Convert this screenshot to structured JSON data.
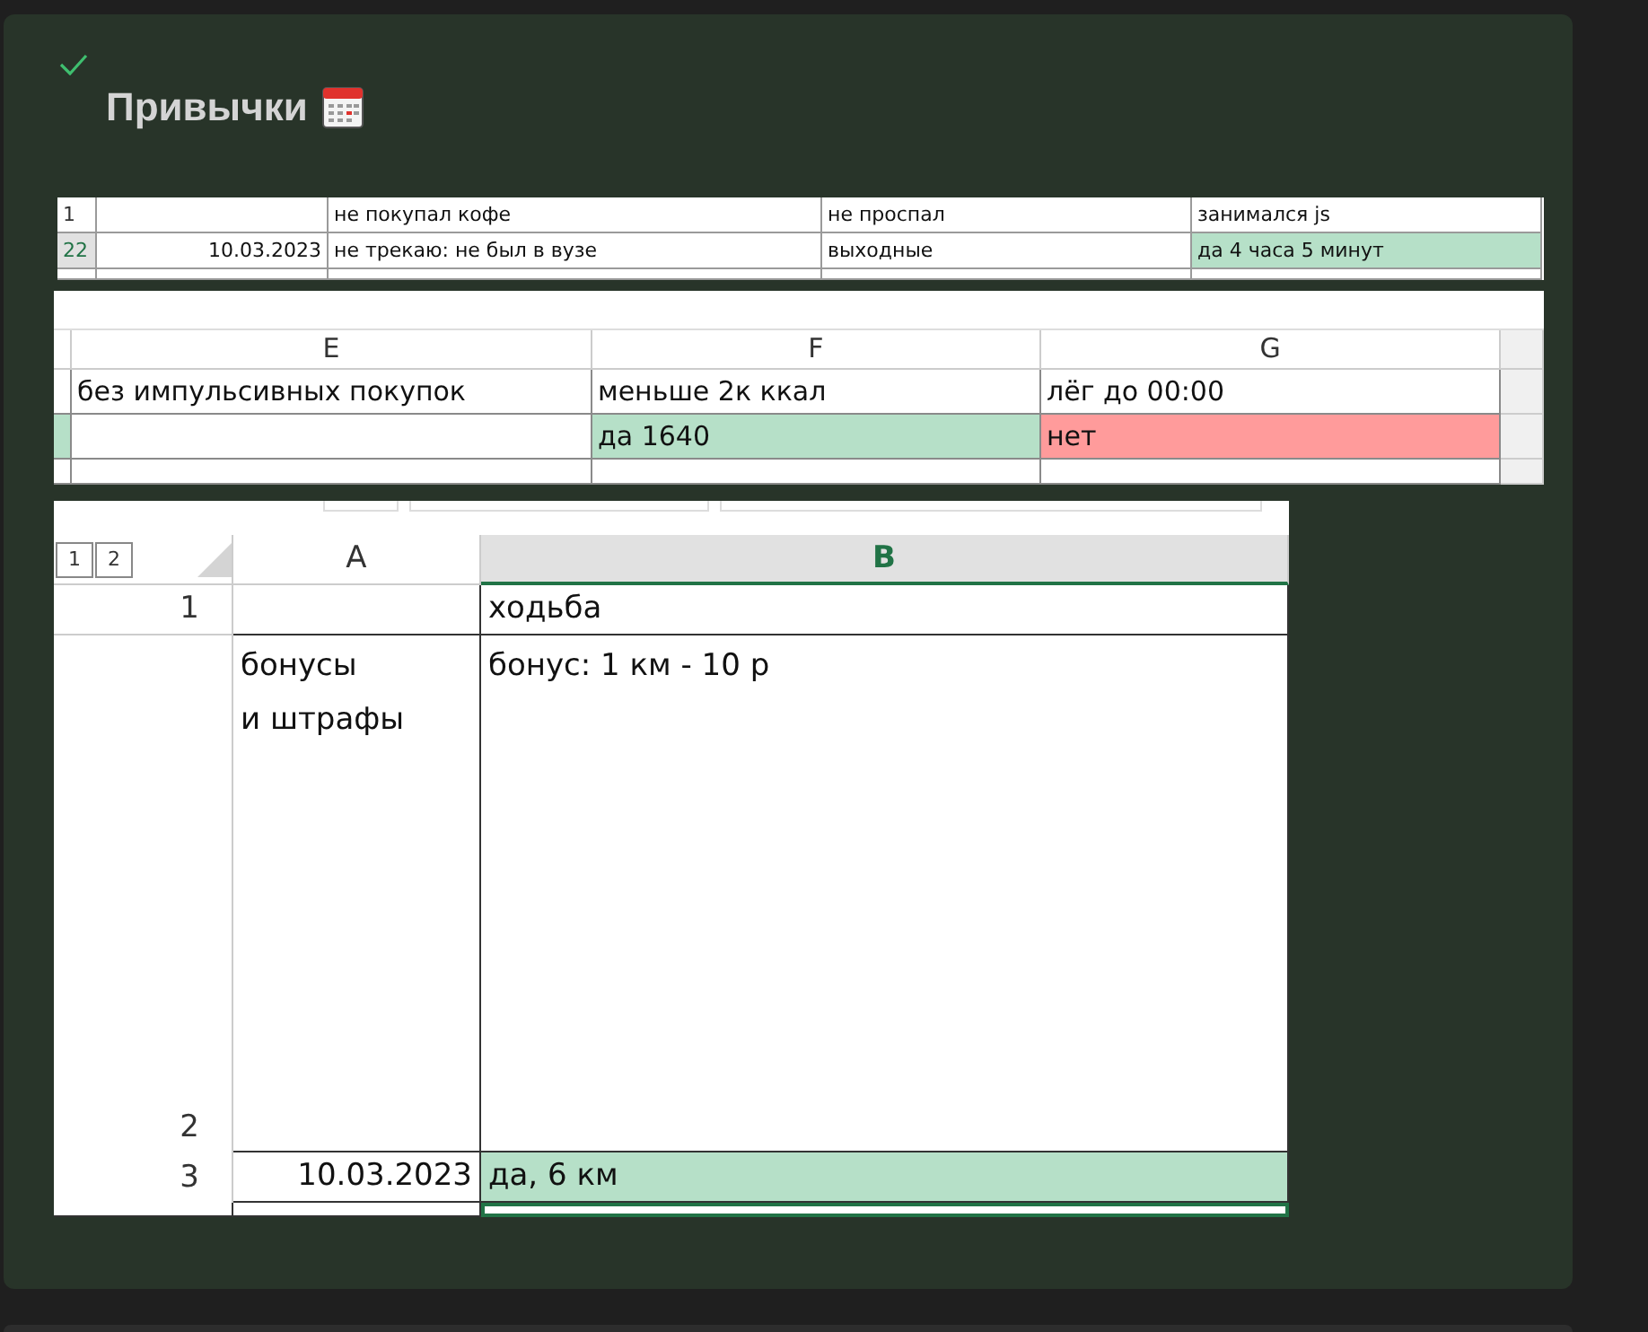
{
  "task": {
    "done": true,
    "title": "Привычки"
  },
  "sheet_1": {
    "rows": [
      {
        "header": "1",
        "selected": false,
        "cells": [
          {},
          {
            "kind": "text",
            "text": "не покупал кофе"
          },
          {
            "kind": "text",
            "text": "не проспал"
          },
          {
            "kind": "text",
            "text": "занимался js"
          }
        ]
      },
      {
        "header": "22",
        "selected": true,
        "cells": [
          {
            "kind": "number",
            "text": "10.03.2023"
          },
          {
            "kind": "text",
            "text": "не трекаю: не был в вузе"
          },
          {
            "kind": "text",
            "text": "выходные"
          },
          {
            "kind": "text",
            "text": "да 4 часа 5 минут",
            "color": "#b6e0c8"
          }
        ]
      }
    ]
  },
  "sheet_2": {
    "columns": [
      {
        "selected": false
      },
      {
        "letter": "E",
        "selected": false
      },
      {
        "letter": "F",
        "selected": false
      },
      {
        "letter": "G",
        "selected": false
      }
    ],
    "rows": [
      {
        "cells": [
          {},
          {
            "kind": "text",
            "text": "без импульсивных покупок"
          },
          {
            "kind": "text",
            "text": "меньше 2к ккал"
          },
          {
            "kind": "text",
            "text": "лёг до 00:00"
          }
        ]
      },
      {
        "cells": [
          {
            "color": "#b6e0c8"
          },
          {},
          {
            "kind": "text",
            "text": "да 1640",
            "color": "#b6e0c8"
          },
          {
            "kind": "text",
            "text": "нет",
            "color": "#ff9b9b"
          }
        ]
      }
    ]
  },
  "sheet_3": {
    "outline_levels": [
      "1",
      "2"
    ],
    "columns": [
      {
        "letter": "A",
        "selected": false
      },
      {
        "letter": "B",
        "selected": true
      }
    ],
    "rows": [
      {
        "header": "1",
        "cells": [
          {},
          {
            "kind": "text",
            "text": "ходьба"
          }
        ]
      },
      {
        "header": "2",
        "cells": [
          {
            "kind": "text",
            "text": "бонусы\nи штрафы"
          },
          {
            "kind": "text",
            "text": "бонус: 1 км - 10 р"
          }
        ]
      },
      {
        "header": "3",
        "cells": [
          {
            "kind": "number",
            "text": "10.03.2023"
          },
          {
            "kind": "text",
            "text": "да, 6 км",
            "color": "#b6e0c8"
          }
        ]
      }
    ]
  }
}
